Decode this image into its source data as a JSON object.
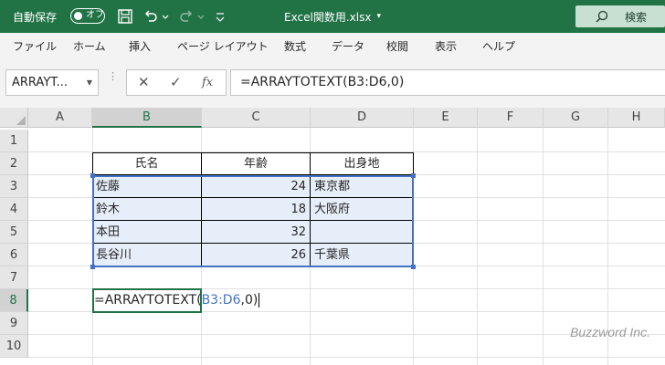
{
  "titlebar": {
    "autosave_label": "自動保存",
    "autosave_state": "オフ",
    "filename": "Excel関数用.xlsx",
    "search_label": "検索",
    "bg_color": "#217346"
  },
  "ribbon": {
    "tabs": [
      "ファイル",
      "ホーム",
      "挿入",
      "ページ レイアウト",
      "数式",
      "データ",
      "校閲",
      "表示",
      "ヘルプ"
    ]
  },
  "formula_bar": {
    "name_box": "ARRAYT...",
    "fx_label": "fx",
    "formula": "=ARRAYTOTEXT(B3:D6,0)"
  },
  "grid": {
    "columns": [
      "A",
      "B",
      "C",
      "D",
      "E",
      "F",
      "G",
      "H"
    ],
    "rows": [
      "1",
      "2",
      "3",
      "4",
      "5",
      "6",
      "7",
      "8",
      "9",
      "10"
    ],
    "selected_column": "B",
    "selected_row": "8"
  },
  "table": {
    "headers": [
      "氏名",
      "年齢",
      "出身地"
    ],
    "rows": [
      [
        "佐藤",
        "24",
        "東京都"
      ],
      [
        "鈴木",
        "18",
        "大阪府"
      ],
      [
        "本田",
        "32",
        ""
      ],
      [
        "長谷川",
        "26",
        "千葉県"
      ]
    ]
  },
  "active_cell": {
    "ref": "B8",
    "prefix": "=ARRAYTOTEXT(",
    "range_ref": "B3:D6",
    "suffix": ",0)"
  },
  "watermark": "Buzzword Inc."
}
